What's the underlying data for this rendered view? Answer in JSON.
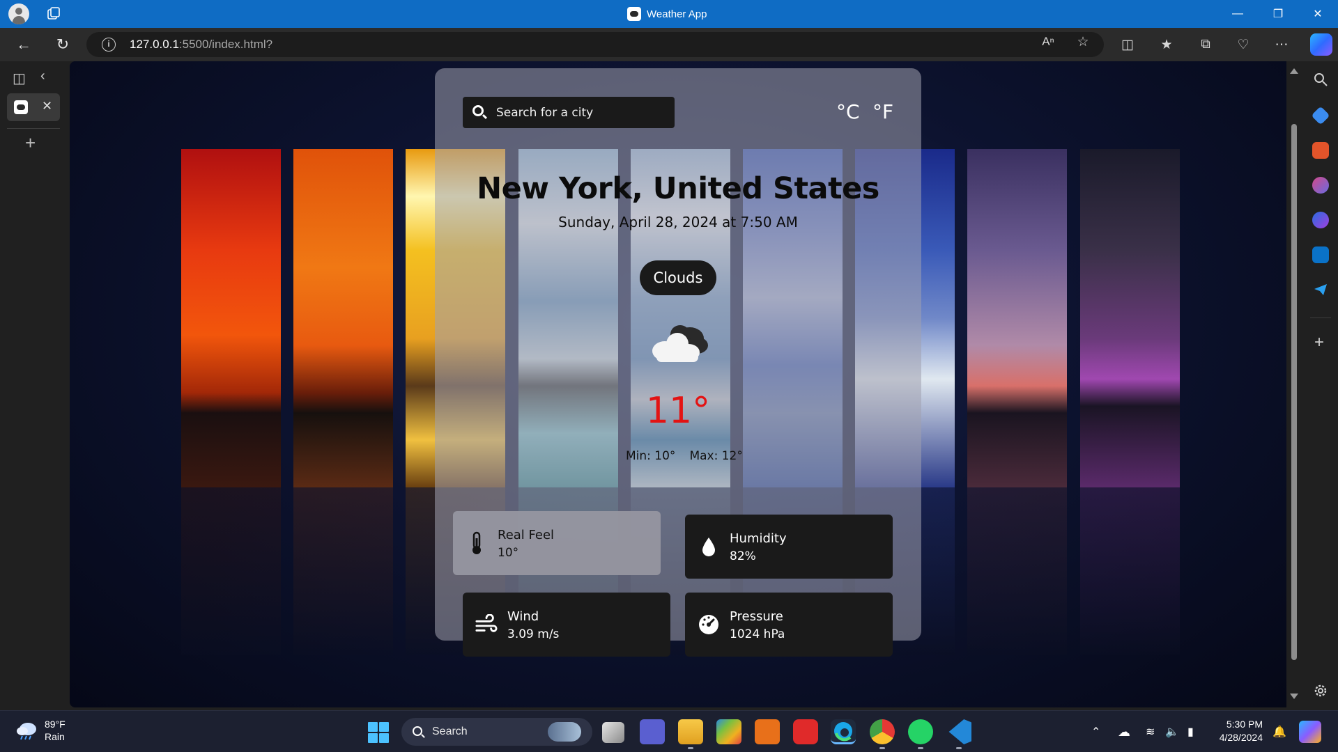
{
  "window": {
    "title": "Weather App"
  },
  "browser": {
    "url_host": "127.0.0.1",
    "url_rest": ":5500/index.html?"
  },
  "weather": {
    "search_placeholder": "Search for a city",
    "units": {
      "celsius": "°C",
      "fahrenheit": "°F"
    },
    "city": "New York, United States",
    "datetime": "Sunday, April 28, 2024 at 7:50 AM",
    "condition": "Clouds",
    "temperature": "11°",
    "min": "Min: 10°",
    "max": "Max: 12°",
    "details": {
      "real_feel": {
        "label": "Real Feel",
        "value": "10°"
      },
      "humidity": {
        "label": "Humidity",
        "value": "82%"
      },
      "wind": {
        "label": "Wind",
        "value": "3.09 m/s"
      },
      "pressure": {
        "label": "Pressure",
        "value": "1024 hPa"
      }
    }
  },
  "taskbar": {
    "weather_temp": "89°F",
    "weather_desc": "Rain",
    "search_label": "Search",
    "time": "5:30 PM",
    "date": "4/28/2024"
  },
  "colors": {
    "titlebar": "#0f6cc4",
    "temperature": "#e31313",
    "accent": "#4cc2ff"
  }
}
